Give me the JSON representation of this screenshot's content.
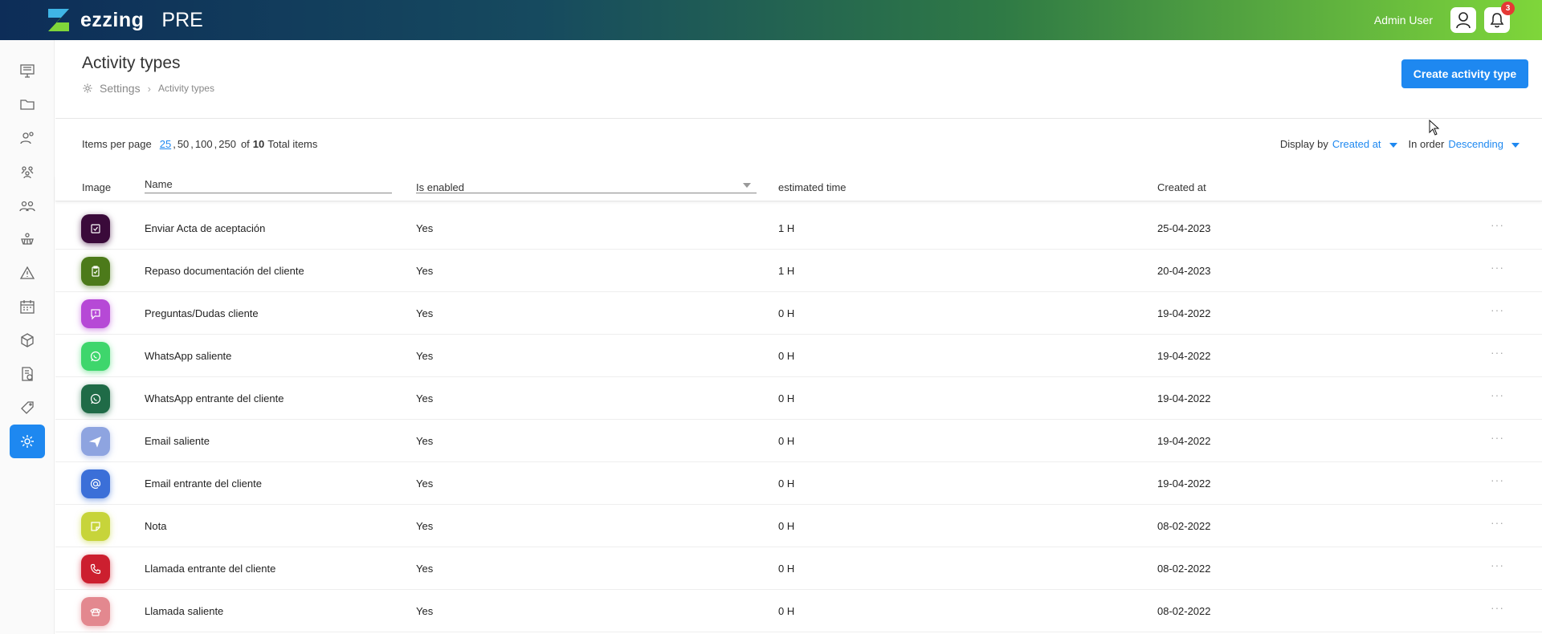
{
  "app": {
    "name": "ezzing",
    "env": "PRE"
  },
  "user": {
    "name": "Admin User",
    "notifications": "3"
  },
  "sidebar": {
    "items": [
      "monitor-icon",
      "folder-icon",
      "contacts-icon",
      "team-icon",
      "users-icon",
      "solar-panel-icon",
      "warning-icon",
      "calendar-icon",
      "box-icon",
      "invoice-icon",
      "tag-icon",
      "settings-icon"
    ],
    "active": "settings-icon"
  },
  "header": {
    "title": "Activity types",
    "breadcrumb": [
      "Settings",
      "Activity types"
    ],
    "create_label": "Create activity type"
  },
  "toolbar": {
    "items_per_page_label": "Items per page",
    "page_sizes": [
      "25",
      "50",
      "100",
      "250"
    ],
    "of_label": "of",
    "total": "10",
    "total_label": "Total items",
    "display_by_label": "Display by",
    "display_by_value": "Created at",
    "order_label": "In order",
    "order_value": "Descending"
  },
  "columns": {
    "image": "Image",
    "name": "Name",
    "enabled": "Is enabled",
    "time": "estimated time",
    "created": "Created at"
  },
  "rows": [
    {
      "name": "Enviar Acta de aceptación",
      "enabled": "Yes",
      "time": "1 H",
      "created": "25-04-2023",
      "color": "#3a0a3a",
      "icon": "checkbox"
    },
    {
      "name": "Repaso documentación del cliente",
      "enabled": "Yes",
      "time": "1 H",
      "created": "20-04-2023",
      "color": "#4c7a1a",
      "icon": "clipboard"
    },
    {
      "name": "Preguntas/Dudas cliente",
      "enabled": "Yes",
      "time": "0 H",
      "created": "19-04-2022",
      "color": "#b649d6",
      "icon": "message"
    },
    {
      "name": "WhatsApp saliente",
      "enabled": "Yes",
      "time": "0 H",
      "created": "19-04-2022",
      "color": "#3ed66c",
      "icon": "whatsapp"
    },
    {
      "name": "WhatsApp entrante del cliente",
      "enabled": "Yes",
      "time": "0 H",
      "created": "19-04-2022",
      "color": "#1f6b47",
      "icon": "whatsapp"
    },
    {
      "name": "Email saliente",
      "enabled": "Yes",
      "time": "0 H",
      "created": "19-04-2022",
      "color": "#8ea4e0",
      "icon": "send"
    },
    {
      "name": "Email entrante del cliente",
      "enabled": "Yes",
      "time": "0 H",
      "created": "19-04-2022",
      "color": "#3b6fd8",
      "icon": "at"
    },
    {
      "name": "Nota",
      "enabled": "Yes",
      "time": "0 H",
      "created": "08-02-2022",
      "color": "#c7d43a",
      "icon": "note"
    },
    {
      "name": "Llamada entrante del cliente",
      "enabled": "Yes",
      "time": "0 H",
      "created": "08-02-2022",
      "color": "#cc1f2f",
      "icon": "phone"
    },
    {
      "name": "Llamada saliente",
      "enabled": "Yes",
      "time": "0 H",
      "created": "08-02-2022",
      "color": "#e3888f",
      "icon": "phone-out"
    }
  ]
}
